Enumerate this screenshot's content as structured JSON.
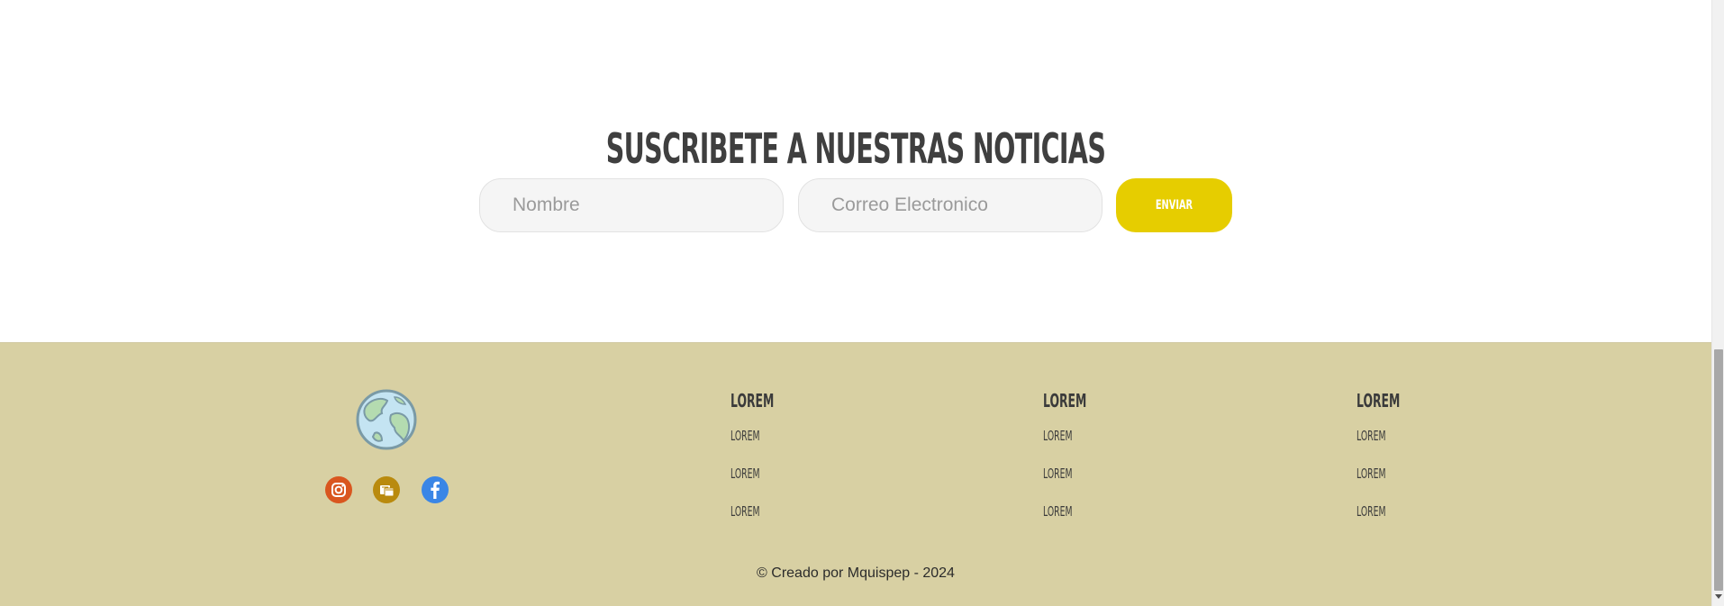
{
  "subscribe": {
    "title": "SUSCRIBETE A NUESTRAS NOTICIAS",
    "name_placeholder": "Nombre",
    "email_placeholder": "Correo Electronico",
    "send_label": "ENVIAR",
    "send_color": "#e6cd00"
  },
  "footer": {
    "background": "#d8d0a3",
    "logo_icon": "globe-icon",
    "social": [
      {
        "icon": "instagram-icon",
        "color": "#d9561f"
      },
      {
        "icon": "mail-icon",
        "color": "#b98a0e"
      },
      {
        "icon": "facebook-icon",
        "color": "#3a86e6"
      }
    ],
    "columns": [
      {
        "heading": "LOREM",
        "links": [
          "LOREM",
          "LOREM",
          "LOREM"
        ]
      },
      {
        "heading": "LOREM",
        "links": [
          "LOREM",
          "LOREM",
          "LOREM"
        ]
      },
      {
        "heading": "LOREM",
        "links": [
          "LOREM",
          "LOREM",
          "LOREM"
        ]
      }
    ],
    "copyright": "© Creado por Mquispep - 2024"
  }
}
